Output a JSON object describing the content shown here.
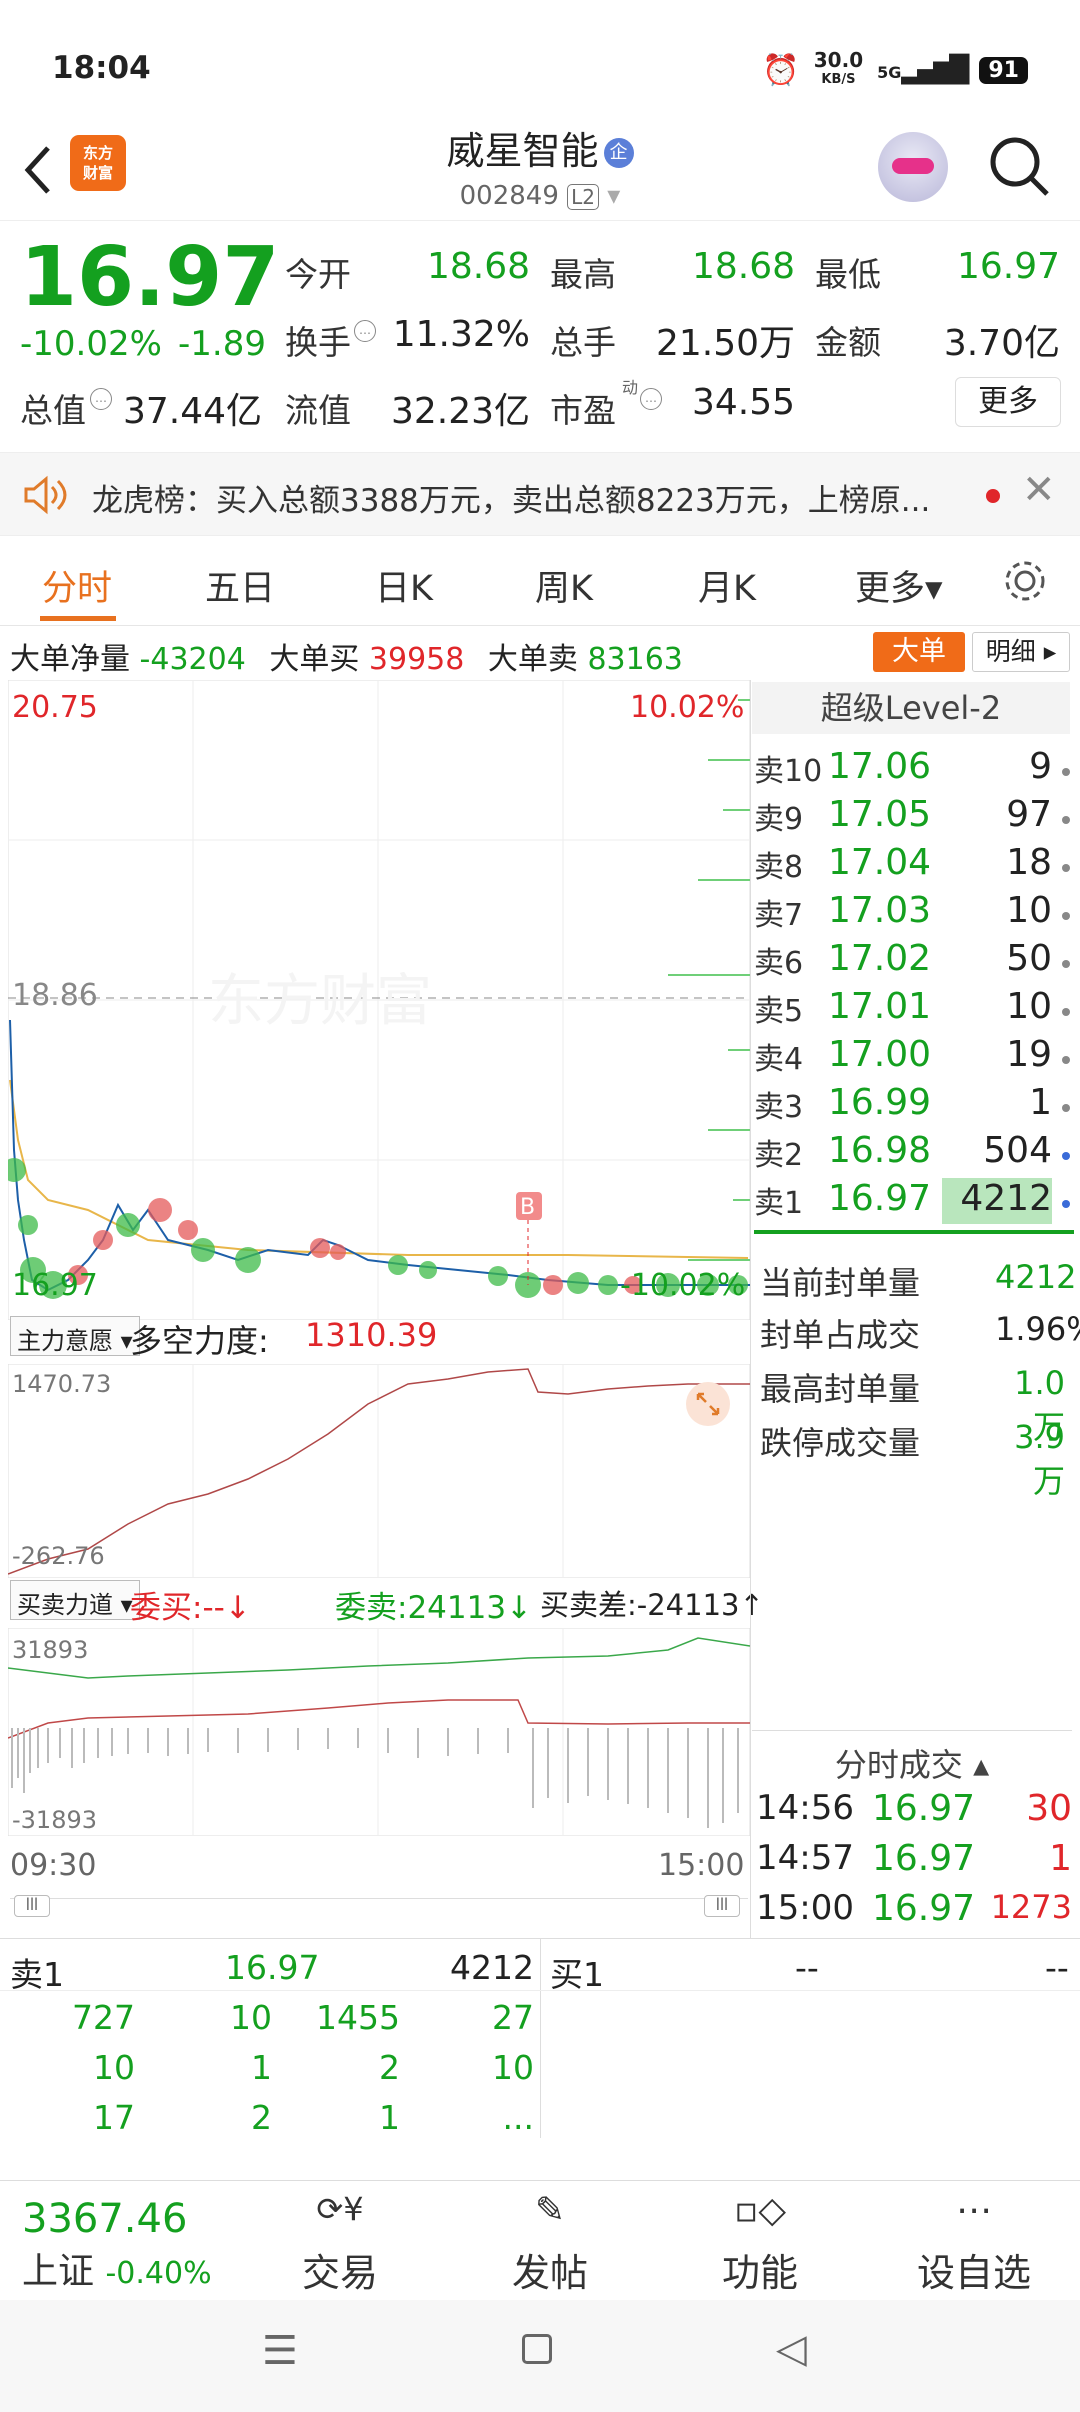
{
  "status": {
    "time": "18:04",
    "net_speed": "30.0",
    "net_unit": "KB/S",
    "signal": "5G",
    "battery": "91"
  },
  "header": {
    "title": "威星智能",
    "code": "002849",
    "badge": "L2",
    "logo_line1": "东方",
    "logo_line2": "财富"
  },
  "quote": {
    "price": "16.97",
    "change_pct": "-10.02%",
    "change": "-1.89",
    "open_label": "今开",
    "open": "18.68",
    "high_label": "最高",
    "high": "18.68",
    "low_label": "最低",
    "low": "16.97",
    "turnover_label": "换手",
    "turnover": "11.32%",
    "volume_label": "总手",
    "volume": "21.50万",
    "amount_label": "金额",
    "amount": "3.70亿",
    "mcap_label": "总值",
    "mcap": "37.44亿",
    "float_label": "流值",
    "float": "32.23亿",
    "pe_label": "市盈",
    "pe_sup": "动",
    "pe": "34.55",
    "more_label": "更多"
  },
  "announcement": {
    "text": "龙虎榜：买入总额3388万元，卖出总额8223万元，上榜原..."
  },
  "tabs": [
    {
      "label": "分时",
      "active": true
    },
    {
      "label": "五日"
    },
    {
      "label": "日K"
    },
    {
      "label": "周K"
    },
    {
      "label": "月K"
    },
    {
      "label": "更多▾"
    }
  ],
  "bigorder": {
    "net_label": "大单净量",
    "net": "-43204",
    "buy_label": "大单买",
    "buy": "39958",
    "sell_label": "大单卖",
    "sell": "83163",
    "btn_big": "大单",
    "btn_detail": "明细"
  },
  "price_chart": {
    "top_price": "20.75",
    "top_pct": "10.02%",
    "ref_price": "18.86",
    "bottom_price": "16.97",
    "bottom_pct": "-10.02%",
    "watermark": "东方财富",
    "marker": "B"
  },
  "indicator1": {
    "selector": "主力意愿",
    "label": "多空力度:",
    "value": "1310.39",
    "max": "1470.73",
    "min": "-262.76"
  },
  "indicator2": {
    "selector": "买卖力道",
    "buy_label": "委买:--",
    "sell_label": "委卖:24113",
    "diff_label": "买卖差:-24113",
    "max": "31893",
    "min": "-31893"
  },
  "time_axis": {
    "start": "09:30",
    "end": "15:00"
  },
  "level2": {
    "title": "超级Level-2",
    "asks": [
      {
        "label": "卖10",
        "price": "17.06",
        "vol": "9"
      },
      {
        "label": "卖9",
        "price": "17.05",
        "vol": "97"
      },
      {
        "label": "卖8",
        "price": "17.04",
        "vol": "18"
      },
      {
        "label": "卖7",
        "price": "17.03",
        "vol": "10"
      },
      {
        "label": "卖6",
        "price": "17.02",
        "vol": "50"
      },
      {
        "label": "卖5",
        "price": "17.01",
        "vol": "10"
      },
      {
        "label": "卖4",
        "price": "17.00",
        "vol": "19"
      },
      {
        "label": "卖3",
        "price": "16.99",
        "vol": "1"
      },
      {
        "label": "卖2",
        "price": "16.98",
        "vol": "504"
      },
      {
        "label": "卖1",
        "price": "16.97",
        "vol": "4212"
      }
    ],
    "info": [
      {
        "label": "当前封单量",
        "value": "4212"
      },
      {
        "label": "封单占成交",
        "value": "1.96%"
      },
      {
        "label": "最高封单量",
        "value": "1.0万"
      },
      {
        "label": "跌停成交量",
        "value": "3.9万"
      }
    ]
  },
  "ticks": {
    "title": "分时成交",
    "rows": [
      {
        "time": "14:56",
        "price": "16.97",
        "vol": "30"
      },
      {
        "time": "14:57",
        "price": "16.97",
        "vol": "1"
      },
      {
        "time": "15:00",
        "price": "16.97",
        "vol": "1273"
      }
    ]
  },
  "queue": {
    "sell1_label": "卖1",
    "sell1_price": "16.97",
    "sell1_vol": "4212",
    "buy1_label": "买1",
    "buy1_price": "--",
    "buy1_vol": "--",
    "rows": [
      [
        "727",
        "10",
        "1455",
        "27"
      ],
      [
        "10",
        "1",
        "2",
        "10"
      ],
      [
        "17",
        "2",
        "1",
        "..."
      ]
    ]
  },
  "dock": {
    "index_value": "3367.46",
    "index_name": "上证",
    "index_change": "-0.40%",
    "items": [
      {
        "label": "交易"
      },
      {
        "label": "发帖"
      },
      {
        "label": "功能"
      },
      {
        "label": "设自选"
      }
    ]
  },
  "colors": {
    "up": "#e0262a",
    "down": "#14a01f",
    "accent": "#f06b18",
    "price_line": "#1d5fa8",
    "avg_line": "#e8b64a"
  }
}
